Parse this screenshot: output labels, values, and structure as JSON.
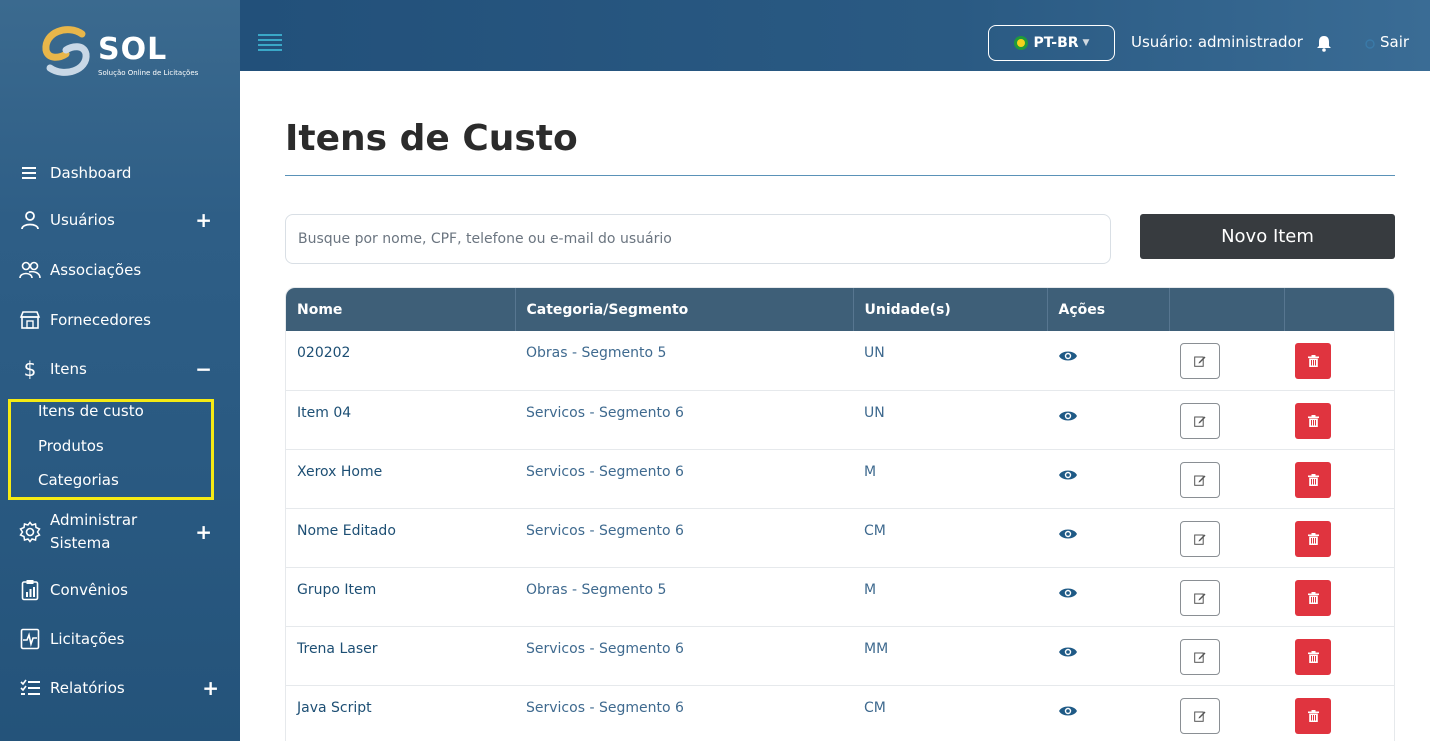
{
  "brand": {
    "name": "SOL",
    "tagline": "Solução Online de Licitações"
  },
  "sidebar": {
    "items": [
      {
        "label": "Dashboard",
        "icon": "menu-lines-icon",
        "toggle": ""
      },
      {
        "label": "Usuários",
        "icon": "user-icon",
        "toggle": "+"
      },
      {
        "label": "Associações",
        "icon": "users-group-icon",
        "toggle": ""
      },
      {
        "label": "Fornecedores",
        "icon": "store-icon",
        "toggle": ""
      },
      {
        "label": "Itens",
        "icon": "dollar-icon",
        "toggle": "−"
      },
      {
        "label": "Administrar\nSistema",
        "icon": "gear-icon",
        "toggle": "+"
      },
      {
        "label": "Convênios",
        "icon": "clipboard-chart-icon",
        "toggle": ""
      },
      {
        "label": "Licitações",
        "icon": "document-pulse-icon",
        "toggle": ""
      },
      {
        "label": "Relatórios",
        "icon": "list-check-icon",
        "toggle": "+"
      }
    ],
    "submenu": [
      "Itens de custo",
      "Produtos",
      "Categorias"
    ]
  },
  "topbar": {
    "language": "PT-BR",
    "user": "Usuário: administrador",
    "logout": "Sair"
  },
  "main": {
    "title": "Itens de Custo",
    "search_placeholder": "Busque por nome, CPF, telefone ou e-mail do usuário",
    "new_button": "Novo Item",
    "columns": [
      "Nome",
      "Categoria/Segmento",
      "Unidade(s)",
      "Ações",
      "",
      ""
    ],
    "rows": [
      {
        "name": "020202",
        "category": "Obras - Segmento 5",
        "unit": "UN"
      },
      {
        "name": "Item 04",
        "category": "Servicos - Segmento 6",
        "unit": "UN"
      },
      {
        "name": "Xerox Home",
        "category": "Servicos - Segmento 6",
        "unit": "M"
      },
      {
        "name": "Nome Editado",
        "category": "Servicos - Segmento 6",
        "unit": "CM"
      },
      {
        "name": "Grupo Item",
        "category": "Obras - Segmento 5",
        "unit": "M"
      },
      {
        "name": "Trena Laser",
        "category": "Servicos - Segmento 6",
        "unit": "MM"
      },
      {
        "name": "Java Script",
        "category": "Servicos - Segmento 6",
        "unit": "CM"
      }
    ]
  },
  "colors": {
    "header_row": "#3e5f78",
    "delete": "#e0343f",
    "highlight": "#f5ea14",
    "primary_button": "#373b3f"
  }
}
